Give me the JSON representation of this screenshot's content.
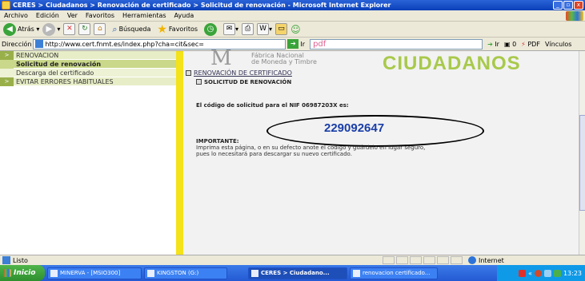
{
  "window": {
    "title": "CERES > Ciudadanos > Renovación de certificado > Solicitud de renovación - Microsoft Internet Explorer"
  },
  "menu": [
    "Archivo",
    "Edición",
    "Ver",
    "Favoritos",
    "Herramientas",
    "Ayuda"
  ],
  "toolbar": {
    "back_label": "Atrás",
    "search_label": "Búsqueda",
    "favorites_label": "Favoritos"
  },
  "address": {
    "label": "Dirección",
    "url": "http://www.cert.fnmt.es/index.php?cha=cit&sec=",
    "go_label": "Ir",
    "pdf_label": "pdf",
    "go2_label": "Ir",
    "count": "0",
    "pdf2_label": "PDF",
    "links_label": "Vínculos"
  },
  "sidebar": {
    "items": [
      {
        "marker": ">",
        "label": "RENOVACION"
      },
      {
        "marker": "",
        "label": "Solicitud de renovación"
      },
      {
        "marker": "",
        "label": "Descarga del certificado"
      },
      {
        "marker": ">",
        "label": "EVITAR ERRORES HABITUALES"
      }
    ]
  },
  "main": {
    "brand_letter": "M",
    "brand_sub_1": "Fábrica Nacional",
    "brand_sub_2": "de Moneda y Timbre",
    "section_banner": "CIUDADANOS",
    "section_link": "RENOVACIÓN DE CERTIFICADO",
    "subheading": "SOLICITUD DE RENOVACIÓN",
    "nif_line": "El código de solicitud para el NIF 06987203X es:",
    "code": "229092647",
    "important_label": "IMPORTANTE:",
    "important_line_1": "Imprima esta página, o en su defecto anote el código y guárdelo en lugar seguro,",
    "important_line_2": "pues lo necesitará para descargar su nuevo certificado."
  },
  "status": {
    "text": "Listo",
    "zone": "Internet"
  },
  "taskbar": {
    "start_label": "Inicio",
    "tasks": [
      "MINERVA - [MSIO300]",
      "KINGSTON (G:)",
      "CERES > Ciudadano...",
      "renovacion certificado..."
    ],
    "clock": "13:23"
  }
}
